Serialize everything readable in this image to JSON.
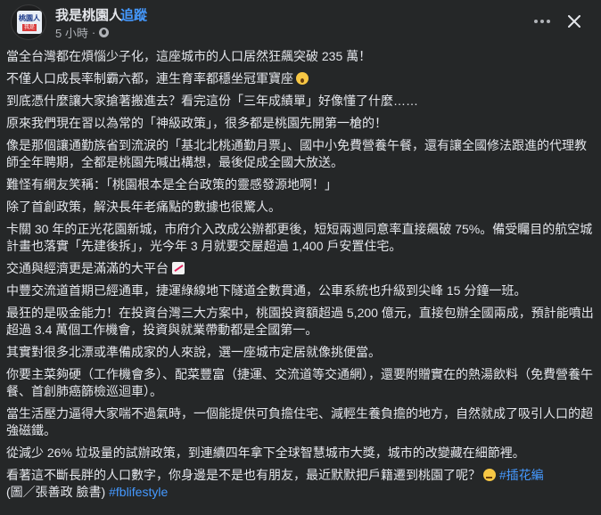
{
  "header": {
    "page_name": "我是桃園人",
    "separator": "·",
    "follow_label": "追蹤",
    "time": "5 小時",
    "time_sep": "·",
    "avatar_text_top": "桃園人",
    "avatar_text_bottom": "我是"
  },
  "icons": {
    "more": "more-horizontal-icon",
    "close": "close-icon",
    "privacy": "globe-icon"
  },
  "colors": {
    "background": "#252728",
    "text": "#e4e6eb",
    "secondary": "#b0b3b8",
    "link": "#4599ff"
  },
  "post": {
    "p1": "當全台灣都在煩惱少子化，這座城市的人口居然狂飆突破 235 萬！",
    "p2": "不僅人口成長率制霸六都，連生育率都穩坐冠軍寶座",
    "p3": "到底憑什麼讓大家搶著搬進去？看完這份「三年成績單」好像懂了什麼……",
    "p4": "原來我們現在習以為常的「神級政策」，很多都是桃園先開第一槍的！",
    "p5": "像是那個讓通勤族省到流淚的「基北北桃通勤月票」、國中小免費營養午餐，還有讓全國修法跟進的代理教師全年聘期，全都是桃園先喊出構想，最後促成全國大放送。",
    "p6": "難怪有網友笑稱：「桃園根本是全台政策的靈感發源地啊！」",
    "p7": "除了首創政策，解決長年老痛點的數據也很驚人。",
    "p8": "卡關 30 年的正光花園新城，市府介入改成公辦都更後，短短兩週同意率直接飆破 75%。備受矚目的航空城計畫也落實「先建後拆」，光今年 3 月就要交屋超過 1,400 戶安置住宅。",
    "p9": "交通與經濟更是滿滿的大平台",
    "p10": "中豐交流道首期已經通車，捷運綠線地下隧道全數貫通，公車系統也升級到尖峰 15 分鐘一班。",
    "p11": "最狂的是吸金能力！在投資台灣三大方案中，桃園投資額超過 5,200 億元，直接包辦全國兩成，預計能噴出超過 3.4 萬個工作機會，投資與就業帶動都是全國第一。",
    "p12": "其實對很多北漂或準備成家的人來說，選一座城市定居就像挑便當。",
    "p13": "你要主菜夠硬（工作機會多）、配菜豐富（捷運、交流道等交通網），還要附贈實在的熱湯飲料（免費營養午餐、首創肺癌篩檢巡迴車）。",
    "p14": "當生活壓力逼得大家喘不過氣時，一個能提供可負擔住宅、減輕生養負擔的地方，自然就成了吸引人口的超強磁鐵。",
    "p15": "從減少 26% 垃圾量的試辦政策，到連續四年拿下全球智慧城市大獎，城市的改變藏在細節裡。",
    "p16": "看著這不斷長胖的人口數字，你身邊是不是也有朋友，最近默默把戶籍遷到桃園了呢？",
    "hashtag1": "#插花編",
    "credit": "(圖／張善政 臉書)",
    "hashtag2": "#fblifestyle"
  }
}
